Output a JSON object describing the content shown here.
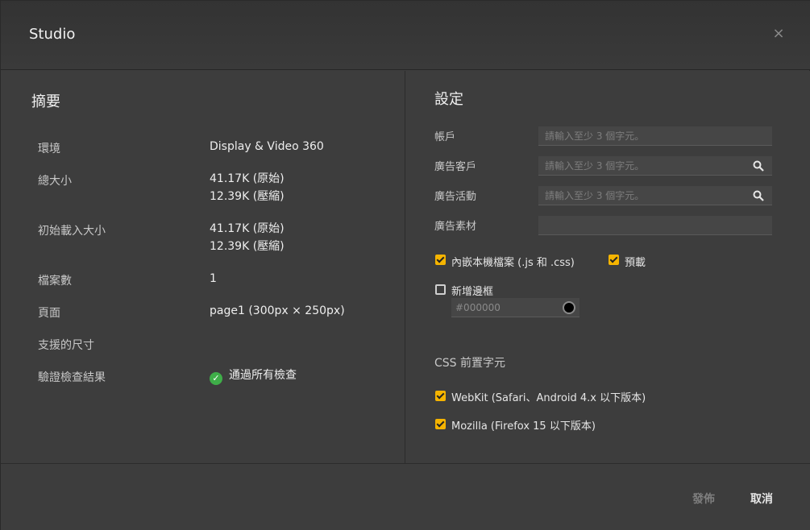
{
  "dialog": {
    "title": "Studio",
    "close_label": "×"
  },
  "summary": {
    "title": "摘要",
    "rows": [
      {
        "label": "環境",
        "value": "Display & Video 360"
      },
      {
        "label": "總大小",
        "value": "41.17K (原始)",
        "value2": "12.39K (壓縮)"
      },
      {
        "label": "初始載入大小",
        "value": "41.17K (原始)",
        "value2": "12.39K (壓縮)"
      },
      {
        "label": "檔案數",
        "value": "1"
      },
      {
        "label": "頁面",
        "value": "page1 (300px × 250px)"
      },
      {
        "label": "支援的尺寸",
        "value": ""
      },
      {
        "label": "驗證檢查結果",
        "value": "通過所有檢查",
        "status_icon": "check-circle-icon",
        "status_color": "#3fae49"
      }
    ]
  },
  "settings": {
    "title": "設定",
    "fields": [
      {
        "label": "帳戶",
        "placeholder": "請輸入至少 3 個字元。",
        "value": ""
      },
      {
        "label": "廣告客戶",
        "placeholder": "請輸入至少 3 個字元。",
        "value": "",
        "icon": "search-icon"
      },
      {
        "label": "廣告活動",
        "placeholder": "請輸入至少 3 個字元。",
        "value": "",
        "icon": "search-icon"
      },
      {
        "label": "廣告素材",
        "placeholder": "",
        "value": ""
      }
    ],
    "inline_files": {
      "label": "內嵌本機檔案 (.js 和 .css)",
      "checked": true
    },
    "preload": {
      "label": "預載",
      "checked": true
    },
    "add_border": {
      "label": "新增邊框",
      "checked": false,
      "color_placeholder": "#000000",
      "color_value": "#000000"
    },
    "css_prefix": {
      "title": "CSS 前置字元",
      "webkit": {
        "label": "WebKit (Safari、Android 4.x 以下版本)",
        "checked": true
      },
      "mozilla": {
        "label": "Mozilla (Firefox 15 以下版本)",
        "checked": true
      }
    }
  },
  "footer": {
    "publish_label": "發佈",
    "cancel_label": "取消"
  },
  "colors": {
    "accent": "#f5b400",
    "success": "#3fae49"
  }
}
